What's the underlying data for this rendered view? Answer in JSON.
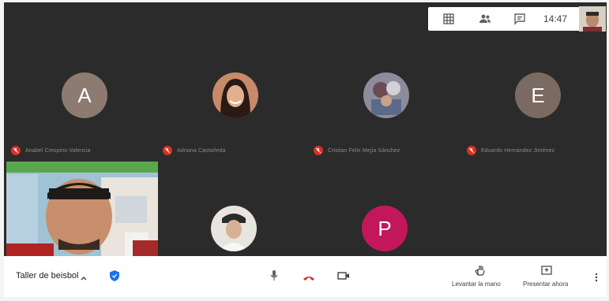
{
  "topbar": {
    "time": "14:47",
    "icons": [
      "grid-icon",
      "people-icon",
      "chat-icon"
    ]
  },
  "participants": [
    {
      "initial": "A",
      "name": "Anabel Crespino Valencia",
      "color": "#8d7b72"
    },
    {
      "initial": "",
      "name": "Adriana Castañeda",
      "color": "#c98a6a"
    },
    {
      "initial": "",
      "name": "Cristian Felix Mejía Sánchez",
      "color": "#7a6c74"
    },
    {
      "initial": "E",
      "name": "Eduardo Hernández Jiménez",
      "color": "#7b6a62"
    },
    {
      "initial": "",
      "name": "",
      "color": "#e8e4df"
    },
    {
      "initial": "P",
      "name": "",
      "color": "#c2185b"
    }
  ],
  "bottom": {
    "meeting_title": "Taller de beisbol",
    "raise_hand_label": "Levantar la mano",
    "present_label": "Presentar ahora"
  },
  "colors": {
    "stage": "#2b2b2b",
    "mute_red": "#d93025",
    "hangup_red": "#d93025",
    "shield_blue": "#1a73e8"
  }
}
